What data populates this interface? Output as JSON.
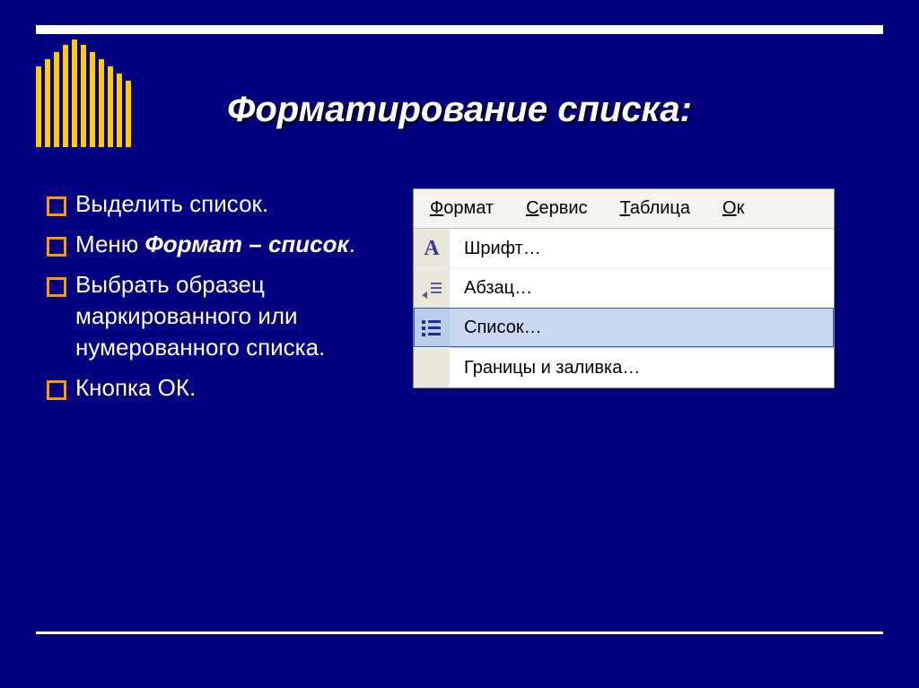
{
  "slide": {
    "title": "Форматирование списка:"
  },
  "bullets": {
    "b0": "Выделить список.",
    "b1_prefix": "Меню ",
    "b1_em": "Формат – список",
    "b1_suffix": ".",
    "b2": "Выбрать образец маркированного или нумерованного списка.",
    "b3": "Кнопка ОК."
  },
  "menubar": {
    "m0a": "Ф",
    "m0b": "ормат",
    "m1a": "С",
    "m1b": "ервис",
    "m2a": "Т",
    "m2b": "аблица",
    "m3a": "О",
    "m3b": "к"
  },
  "dropdown": {
    "i0u": "Ш",
    "i0r": "рифт…",
    "i1": "Аб",
    "i1u": "з",
    "i1r": "ац…",
    "i2": "С",
    "i2u": "п",
    "i2r": "исок…",
    "i3u": "Г",
    "i3r": "раницы и заливка…"
  }
}
